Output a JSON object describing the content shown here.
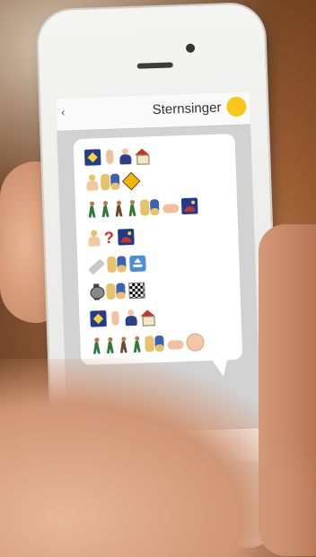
{
  "app": {
    "title": "Sternsinger",
    "back_icon": "chevron-left-icon",
    "back_glyph": "‹",
    "logo_color": "#f7c81a"
  },
  "message": {
    "rows": [
      [
        "star-sky-icon",
        "pointing-up-finger-icon",
        "three-kings-icon",
        "house-icon"
      ],
      [
        "blond-person-icon",
        "family-icon",
        "school-crossing-icon"
      ],
      [
        "walker-icon",
        "walker-icon",
        "walker-icon",
        "walker-icon",
        "family-icon",
        "pointing-hand-icon",
        "sunset-icon"
      ],
      [
        "blond-person-icon",
        "question-mark-icon",
        "sunset-icon"
      ],
      [
        "flashlight-icon",
        "family-icon",
        "elevator-icon"
      ],
      [
        "watch-icon",
        "family-icon",
        "checkered-flag-icon"
      ],
      [
        "star-sky-icon",
        "pointing-up-finger-icon",
        "three-kings-icon",
        "house-icon"
      ],
      [
        "walker-icon",
        "walker-icon",
        "walker-icon",
        "walker-icon",
        "family-icon",
        "pointing-hand-icon",
        "baby-icon"
      ]
    ]
  },
  "colors": {
    "bubble": "#ffffff",
    "chat_background": "#d2d2d2",
    "accent": "#f7c81a"
  }
}
